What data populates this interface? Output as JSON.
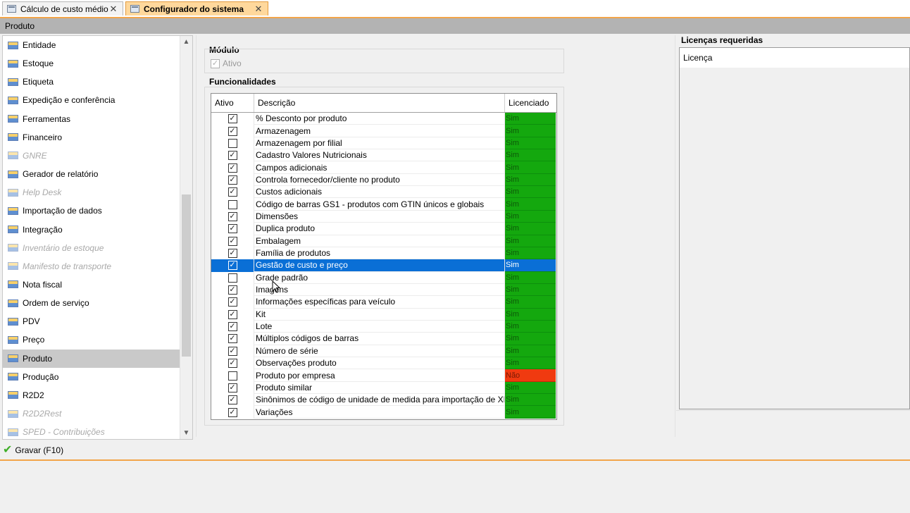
{
  "tabs": [
    {
      "label": "Cálculo de custo médio",
      "close": "✕",
      "active": false
    },
    {
      "label": "Configurador do sistema",
      "close": "✕",
      "active": true
    }
  ],
  "title": "Produto",
  "sidebar": {
    "items": [
      {
        "label": "Entidade",
        "enabled": true
      },
      {
        "label": "Estoque",
        "enabled": true
      },
      {
        "label": "Etiqueta",
        "enabled": true
      },
      {
        "label": "Expedição e conferência",
        "enabled": true
      },
      {
        "label": "Ferramentas",
        "enabled": true
      },
      {
        "label": "Financeiro",
        "enabled": true
      },
      {
        "label": "GNRE",
        "enabled": false
      },
      {
        "label": "Gerador de relatório",
        "enabled": true
      },
      {
        "label": "Help Desk",
        "enabled": false
      },
      {
        "label": "Importação de dados",
        "enabled": true
      },
      {
        "label": "Integração",
        "enabled": true
      },
      {
        "label": "Inventário de estoque",
        "enabled": false
      },
      {
        "label": "Manifesto de transporte",
        "enabled": false
      },
      {
        "label": "Nota fiscal",
        "enabled": true
      },
      {
        "label": "Ordem de serviço",
        "enabled": true
      },
      {
        "label": "PDV",
        "enabled": true
      },
      {
        "label": "Preço",
        "enabled": true
      },
      {
        "label": "Produto",
        "enabled": true,
        "selected": true
      },
      {
        "label": "Produção",
        "enabled": true
      },
      {
        "label": "R2D2",
        "enabled": true
      },
      {
        "label": "R2D2Rest",
        "enabled": false
      },
      {
        "label": "SPED - Contribuições",
        "enabled": false
      }
    ]
  },
  "module": {
    "title": "Módulo",
    "ativo_label": "Ativo",
    "ativo_checked": true
  },
  "functionalities": {
    "title": "Funcionalidades",
    "columns": [
      "Ativo",
      "Descrição",
      "Licenciado"
    ],
    "rows": [
      {
        "checked": true,
        "desc": "% Desconto por produto",
        "lic": "Sim"
      },
      {
        "checked": true,
        "desc": "Armazenagem",
        "lic": "Sim"
      },
      {
        "checked": false,
        "desc": "Armazenagem por filial",
        "lic": "Sim"
      },
      {
        "checked": true,
        "desc": "Cadastro Valores Nutricionais",
        "lic": "Sim"
      },
      {
        "checked": true,
        "desc": "Campos adicionais",
        "lic": "Sim"
      },
      {
        "checked": true,
        "desc": "Controla fornecedor/cliente no produto",
        "lic": "Sim"
      },
      {
        "checked": true,
        "desc": "Custos adicionais",
        "lic": "Sim"
      },
      {
        "checked": false,
        "desc": "Código de barras GS1 - produtos com GTIN únicos e globais",
        "lic": "Sim"
      },
      {
        "checked": true,
        "desc": "Dimensões",
        "lic": "Sim"
      },
      {
        "checked": true,
        "desc": "Duplica produto",
        "lic": "Sim"
      },
      {
        "checked": true,
        "desc": "Embalagem",
        "lic": "Sim"
      },
      {
        "checked": true,
        "desc": "Família de produtos",
        "lic": "Sim"
      },
      {
        "checked": true,
        "desc": "Gestão de custo e preço",
        "lic": "Sim",
        "selected": true
      },
      {
        "checked": false,
        "desc": "Grade padrão",
        "lic": "Sim"
      },
      {
        "checked": true,
        "desc": "Imagens",
        "lic": "Sim"
      },
      {
        "checked": true,
        "desc": "Informações específicas para veículo",
        "lic": "Sim"
      },
      {
        "checked": true,
        "desc": "Kit",
        "lic": "Sim"
      },
      {
        "checked": true,
        "desc": "Lote",
        "lic": "Sim"
      },
      {
        "checked": true,
        "desc": "Múltiplos códigos de barras",
        "lic": "Sim"
      },
      {
        "checked": true,
        "desc": "Número de série",
        "lic": "Sim"
      },
      {
        "checked": true,
        "desc": "Observações produto",
        "lic": "Sim"
      },
      {
        "checked": false,
        "desc": "Produto por empresa",
        "lic": "Não"
      },
      {
        "checked": true,
        "desc": "Produto similar",
        "lic": "Sim"
      },
      {
        "checked": true,
        "desc": "Sinônimos de código de unidade de medida para importação de XML",
        "lic": "Sim"
      },
      {
        "checked": true,
        "desc": "Variações",
        "lic": "Sim"
      }
    ]
  },
  "licenses": {
    "title": "Licenças requeridas",
    "column": "Licença"
  },
  "save_label": "Gravar (F10)",
  "colors": {
    "licensed": "#14a80e",
    "not_licensed": "#f03a10",
    "selection": "#0a6fd6",
    "accent": "#f2a54a"
  }
}
